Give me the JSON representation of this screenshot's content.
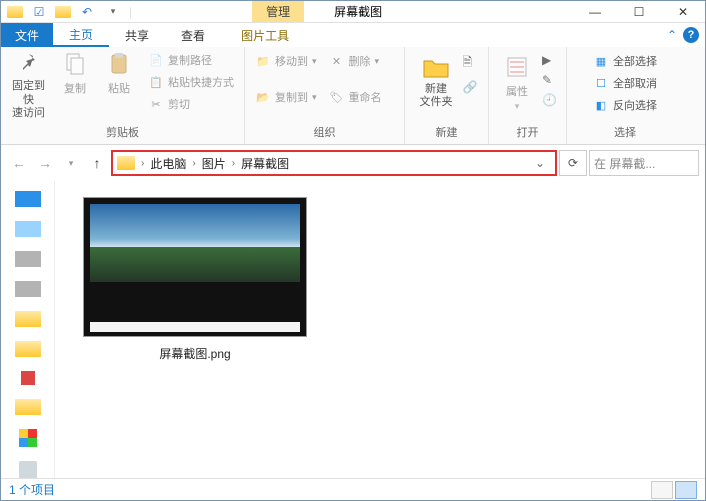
{
  "window": {
    "manage_label": "管理",
    "tools_label": "图片工具",
    "title": "屏幕截图"
  },
  "tabs": {
    "file": "文件",
    "home": "主页",
    "share": "共享",
    "view": "查看",
    "image_tools": "图片工具"
  },
  "ribbon": {
    "pin": "固定到快\n速访问",
    "copy": "复制",
    "paste": "粘贴",
    "copy_path": "复制路径",
    "paste_shortcut": "粘贴快捷方式",
    "cut": "剪切",
    "group_clipboard": "剪贴板",
    "move_to": "移动到",
    "copy_to": "复制到",
    "delete": "删除",
    "rename": "重命名",
    "group_organize": "组织",
    "new_folder": "新建\n文件夹",
    "group_new": "新建",
    "properties": "属性",
    "group_open": "打开",
    "select_all": "全部选择",
    "select_none": "全部取消",
    "invert": "反向选择",
    "group_select": "选择"
  },
  "breadcrumb": {
    "root": "此电脑",
    "pictures": "图片",
    "folder": "屏幕截图"
  },
  "search": {
    "placeholder": "在 屏幕截..."
  },
  "file": {
    "name": "屏幕截图.png"
  },
  "status": {
    "count": "1 个项目"
  }
}
